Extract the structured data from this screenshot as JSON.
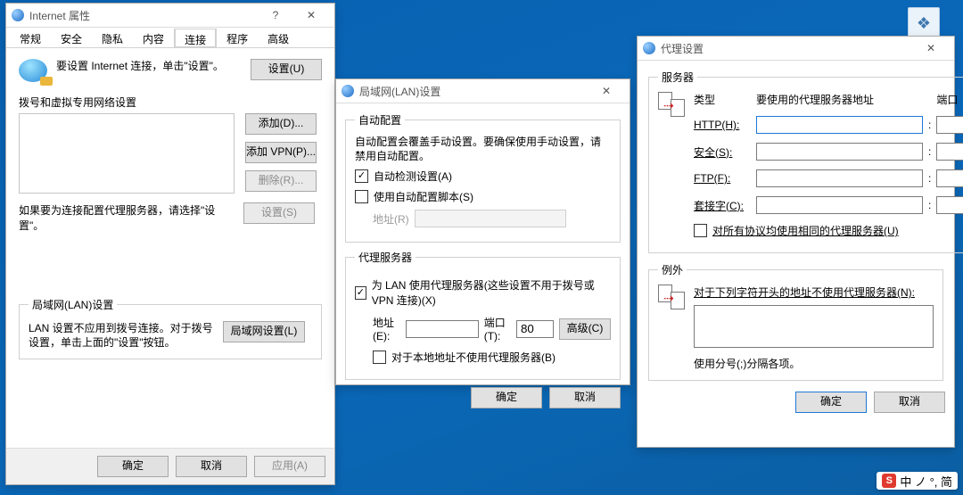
{
  "desktop": {
    "ime_badge_letter": "S",
    "ime_text": "中 ノ °, 简"
  },
  "internet_options": {
    "title": "Internet 属性",
    "tabs": [
      "常规",
      "安全",
      "隐私",
      "内容",
      "连接",
      "程序",
      "高级"
    ],
    "active_tab_index": 4,
    "setup_text": "要设置 Internet 连接，单击\"设置\"。",
    "setup_button": "设置(U)",
    "dialup_section_title": "拨号和虚拟专用网络设置",
    "dialup_buttons": {
      "add": "添加(D)...",
      "add_vpn": "添加 VPN(P)...",
      "remove": "删除(R)..."
    },
    "dialup_hint": "如果要为连接配置代理服务器，请选择\"设置\"。",
    "dialup_settings_button": "设置(S)",
    "lan_group_title": "局域网(LAN)设置",
    "lan_hint": "LAN 设置不应用到拨号连接。对于拨号设置，单击上面的\"设置\"按钮。",
    "lan_settings_button": "局域网设置(L)",
    "footer": {
      "ok": "确定",
      "cancel": "取消",
      "apply": "应用(A)"
    }
  },
  "lan_settings": {
    "title": "局域网(LAN)设置",
    "auto_group_title": "自动配置",
    "auto_group_hint": "自动配置会覆盖手动设置。要确保使用手动设置，请禁用自动配置。",
    "auto_detect_label": "自动检测设置(A)",
    "auto_detect_checked": true,
    "auto_script_label": "使用自动配置脚本(S)",
    "auto_script_checked": false,
    "address_label": "地址(R)",
    "address_value": "",
    "proxy_group_title": "代理服务器",
    "use_proxy_label": "为 LAN 使用代理服务器(这些设置不用于拨号或 VPN 连接)(X)",
    "use_proxy_checked": true,
    "proxy_addr_label": "地址(E):",
    "proxy_addr_value": "",
    "proxy_port_label": "端口(T):",
    "proxy_port_value": "80",
    "advanced_button": "高级(C)",
    "bypass_local_label": "对于本地地址不使用代理服务器(B)",
    "bypass_local_checked": false,
    "footer": {
      "ok": "确定",
      "cancel": "取消"
    }
  },
  "proxy_settings": {
    "title": "代理设置",
    "servers_group_title": "服务器",
    "header_type": "类型",
    "header_addr": "要使用的代理服务器地址",
    "header_port": "端口",
    "rows": {
      "http": {
        "label": "HTTP(H):",
        "value": "",
        "port": ""
      },
      "secure": {
        "label": "安全(S):",
        "value": "",
        "port": ""
      },
      "ftp": {
        "label": "FTP(F):",
        "value": "",
        "port": ""
      },
      "socks": {
        "label": "套接字(C):",
        "value": "",
        "port": ""
      }
    },
    "same_for_all_label": "对所有协议均使用相同的代理服务器(U)",
    "same_for_all_checked": false,
    "exceptions_group_title": "例外",
    "exceptions_hint": "对于下列字符开头的地址不使用代理服务器(N):",
    "exceptions_value": "",
    "exceptions_note": "使用分号(;)分隔各项。",
    "footer": {
      "ok": "确定",
      "cancel": "取消"
    }
  }
}
